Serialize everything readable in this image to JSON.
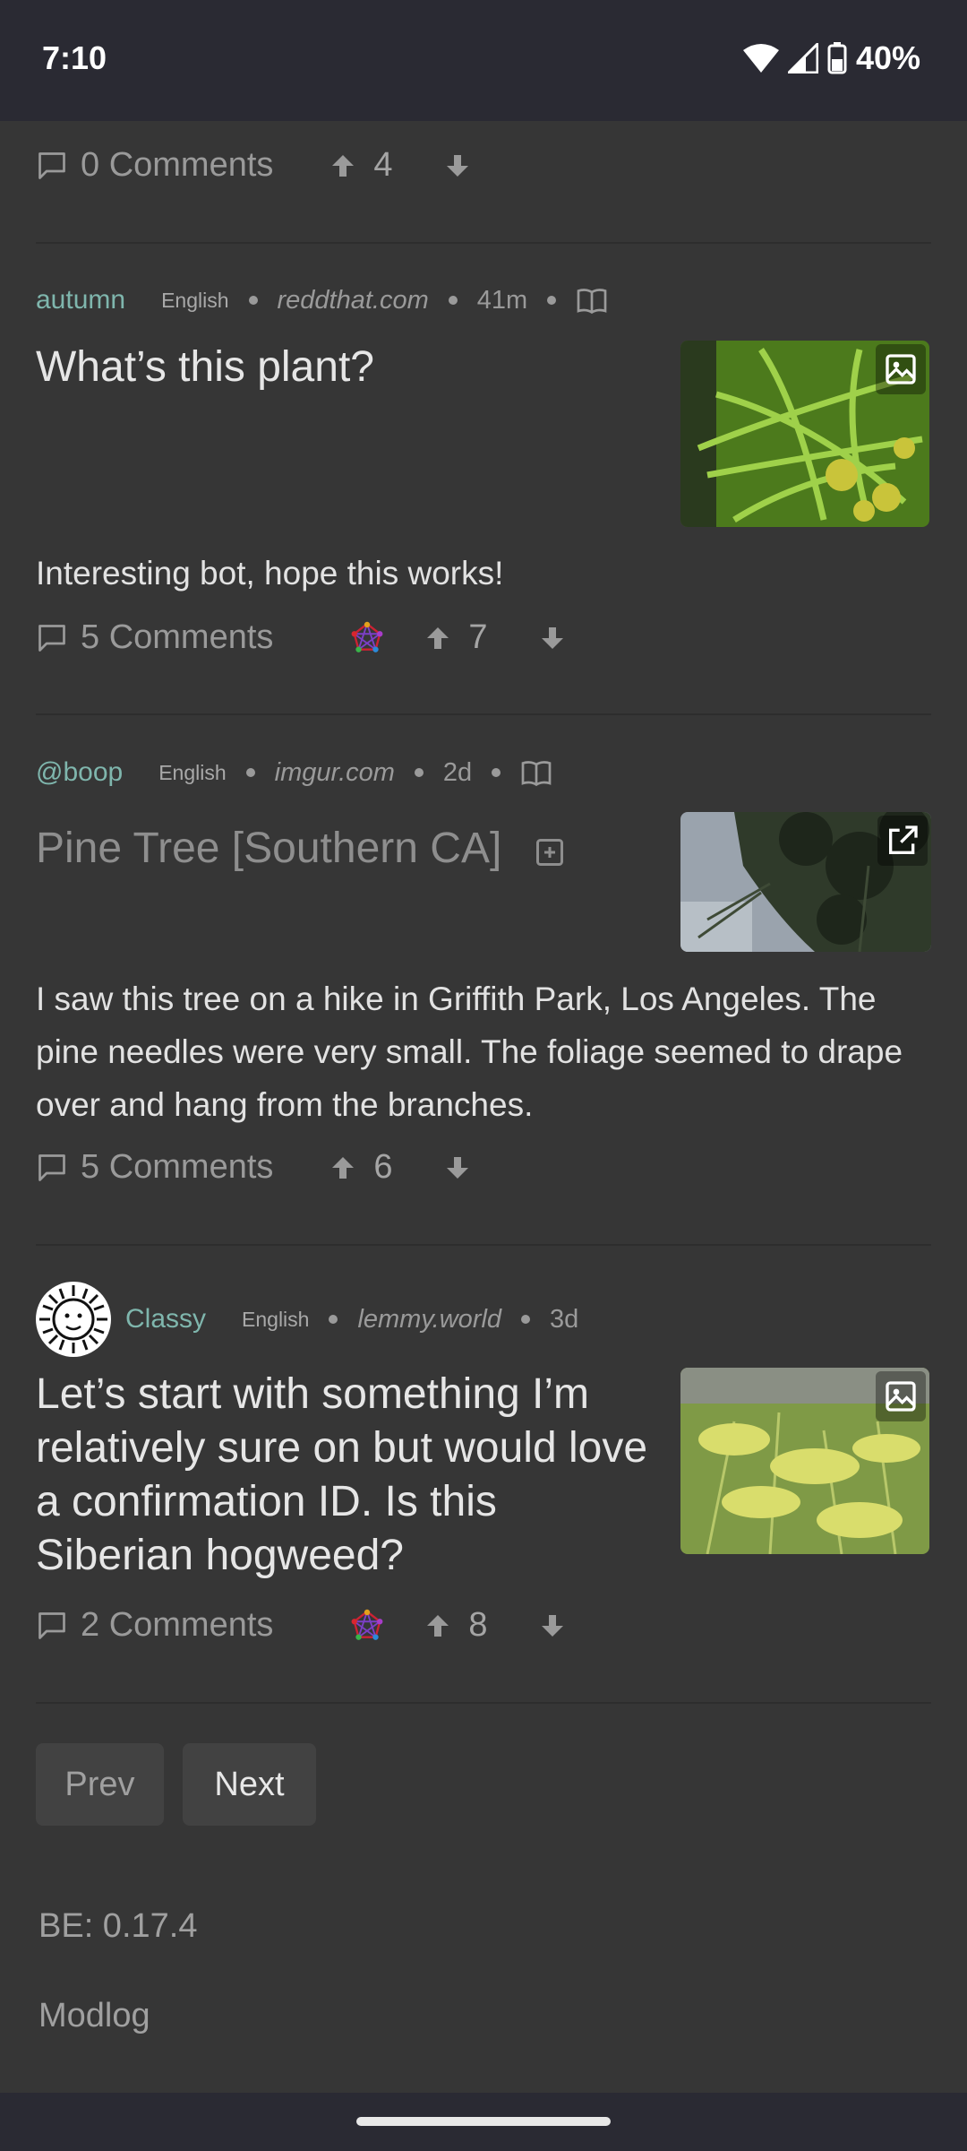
{
  "status": {
    "time": "7:10",
    "battery": "40%"
  },
  "top_row": {
    "comments": "0 Comments",
    "score": "4"
  },
  "posts": [
    {
      "user": "autumn",
      "language": "English",
      "domain": "reddthat.com",
      "age": "41m",
      "title": "What’s this plant?",
      "body": "Interesting bot, hope this works!",
      "comments": "5 Comments",
      "score": "7"
    },
    {
      "user": "@boop",
      "language": "English",
      "domain": "imgur.com",
      "age": "2d",
      "title": "Pine Tree [Southern CA]",
      "body": "I saw this tree on a hike in Griffith Park, Los Angeles. The pine needles were very small. The foliage seemed to drape over and hang from the branches.",
      "comments": "5 Comments",
      "score": "6"
    },
    {
      "user": "Classy",
      "language": "English",
      "domain": "lemmy.world",
      "age": "3d",
      "title": "Let’s start with something I’m relatively sure on but would love a confirmation ID. Is this Siberian hogweed?",
      "comments": "2 Comments",
      "score": "8"
    }
  ],
  "pagination": {
    "prev": "Prev",
    "next": "Next"
  },
  "footer": {
    "version": "BE: 0.17.4",
    "modlog": "Modlog"
  },
  "colors": {
    "accent": "#7fb6ad",
    "background": "#363636",
    "statusbar": "#2a2a33"
  }
}
